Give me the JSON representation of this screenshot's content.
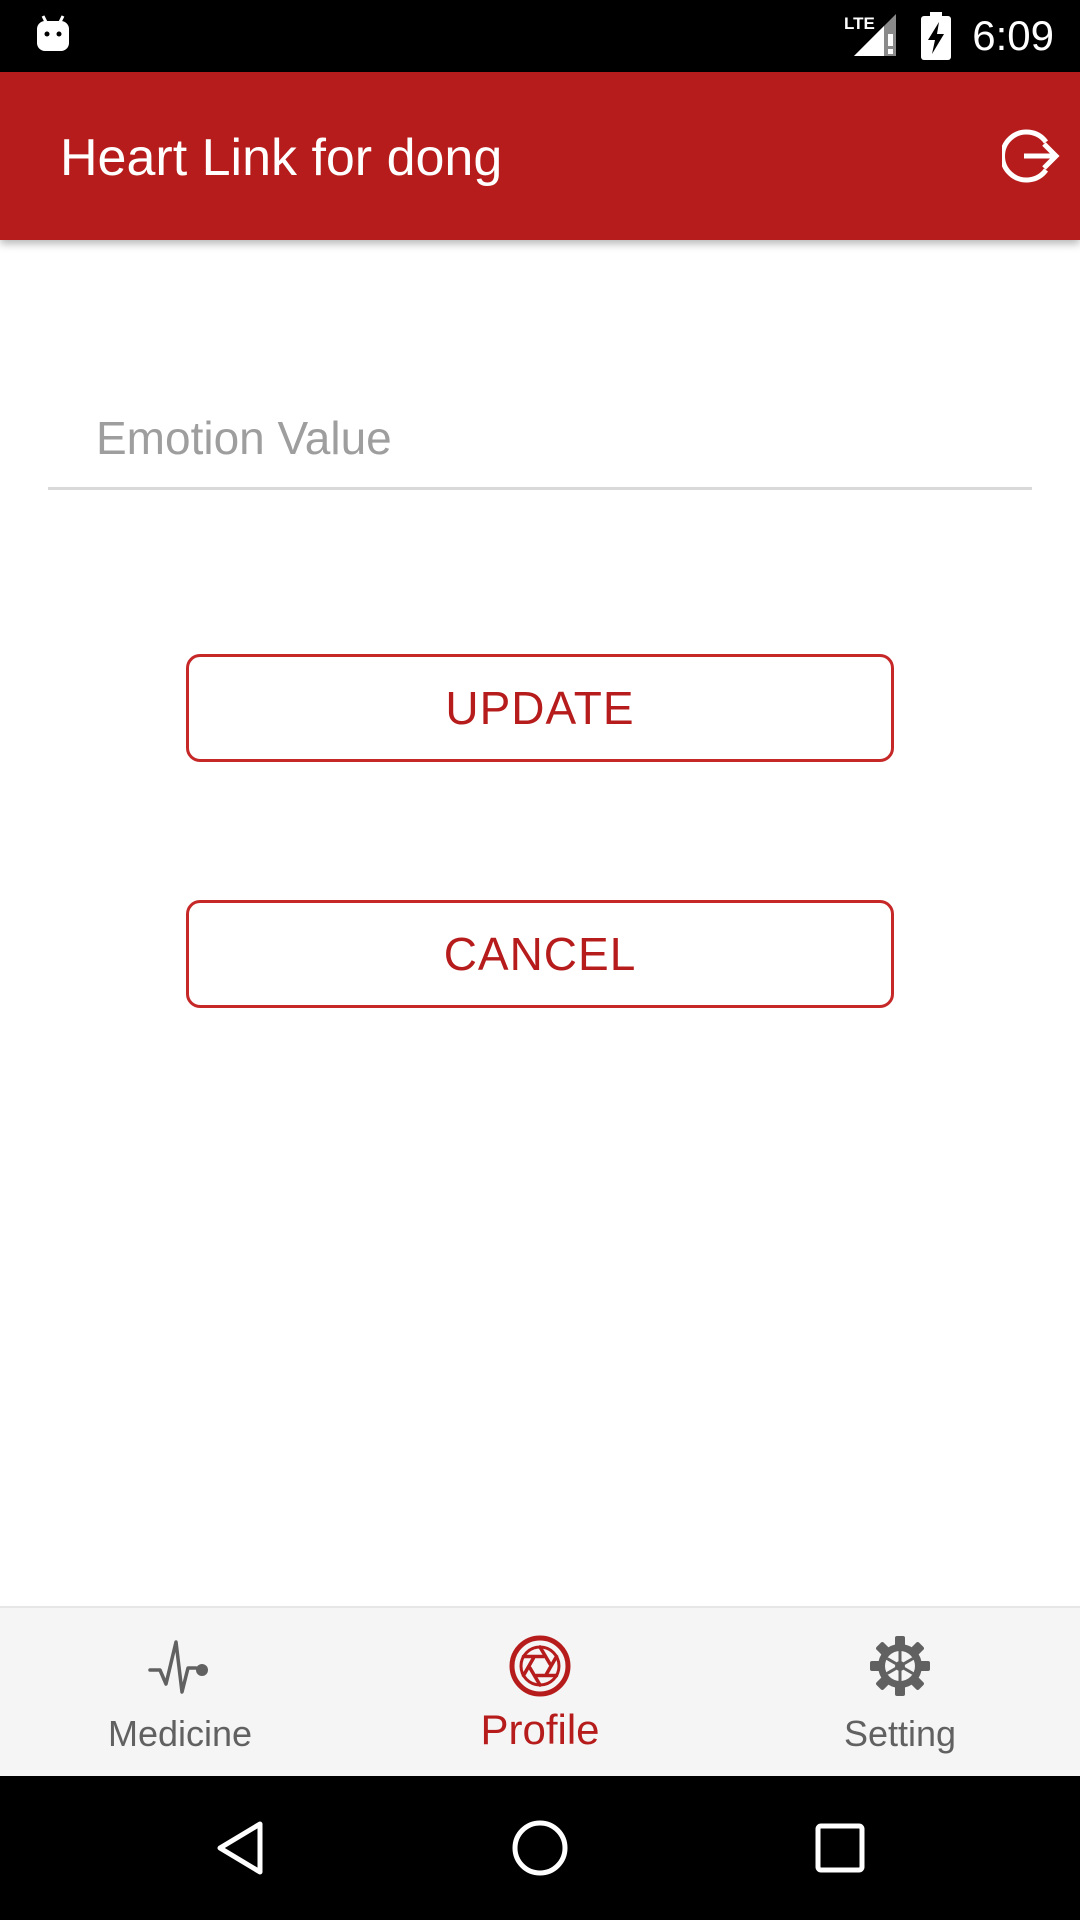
{
  "status_bar": {
    "time": "6:09",
    "network_label": "LTE",
    "icons": [
      "android-notification-icon",
      "lte-signal-icon",
      "battery-charging-icon"
    ]
  },
  "app_bar": {
    "title": "Heart Link for dong",
    "action_icon": "logout-icon"
  },
  "form": {
    "emotion_value": "",
    "emotion_placeholder": "Emotion Value"
  },
  "buttons": {
    "update_label": "UPDATE",
    "cancel_label": "CANCEL"
  },
  "bottom_nav": {
    "items": [
      {
        "label": "Medicine",
        "icon": "heartbeat-icon",
        "active": false
      },
      {
        "label": "Profile",
        "icon": "aperture-icon",
        "active": true
      },
      {
        "label": "Setting",
        "icon": "gear-icon",
        "active": false
      }
    ]
  },
  "system_nav": {
    "icons": [
      "back-icon",
      "home-icon",
      "recents-icon"
    ]
  },
  "colors": {
    "primary": "#b71c1c",
    "button_border": "#c62828",
    "inactive": "#616161",
    "nav_background": "#f5f5f5"
  }
}
